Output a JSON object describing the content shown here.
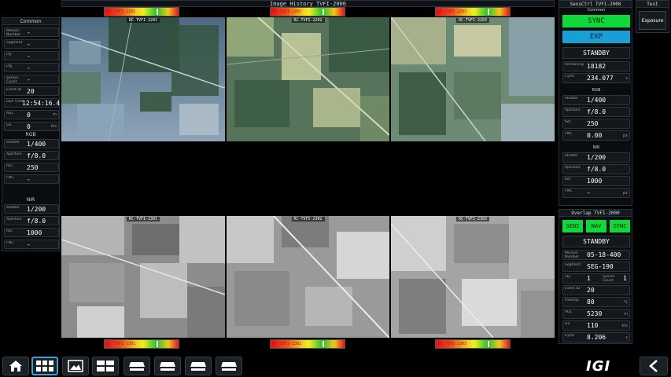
{
  "window": {
    "title": "Image History TVFI-2000"
  },
  "left_panel": {
    "common_title": "Common",
    "common_rows": [
      {
        "key": "Mission Number",
        "value": "-"
      },
      {
        "key": "Segment",
        "value": "-"
      },
      {
        "key": "Lty",
        "value": "-"
      },
      {
        "key": "Lfg",
        "value": "-"
      },
      {
        "key": "Sensor Count",
        "value": "-"
      },
      {
        "key": "Event ID",
        "value": "20"
      },
      {
        "key": "GEP Time",
        "value": "12:54:16.4"
      },
      {
        "key": "AGL",
        "value": "0",
        "unit": "m"
      },
      {
        "key": "GS",
        "value": "0",
        "unit": "kts"
      }
    ],
    "rgb_title": "RGB",
    "rgb_rows": [
      {
        "key": "Shutter",
        "value": "1/400"
      },
      {
        "key": "Aperture",
        "value": "f/8.0"
      },
      {
        "key": "ISO",
        "value": "250"
      },
      {
        "key": "FMC",
        "value": "-"
      }
    ],
    "nir_title": "NIR",
    "nir_rows": [
      {
        "key": "Shutter",
        "value": "1/200"
      },
      {
        "key": "Aperture",
        "value": "f/8.0"
      },
      {
        "key": "ISO",
        "value": "1000"
      },
      {
        "key": "FMC",
        "value": "-"
      }
    ]
  },
  "gauges": {
    "top": [
      {
        "label": "RC-TVFI-2201",
        "marker": 0.7
      },
      {
        "label": "RC-TVFI-2202",
        "marker": 0.7
      },
      {
        "label": "RC-TVFI-2203",
        "marker": 0.7
      }
    ],
    "bottom": [
      {
        "label": "RC-TVFI-2301",
        "marker": 0.7
      },
      {
        "label": "RC-TVFI-2302",
        "marker": 0.7
      },
      {
        "label": "RC-TVFI-2303",
        "marker": 0.7
      }
    ]
  },
  "tiles": {
    "top": [
      {
        "title": "RC-TVFI-2201"
      },
      {
        "title": "RC-TVFI-2202"
      },
      {
        "title": "RC-TVFI-2203"
      }
    ],
    "bottom": [
      {
        "title": "RC-TVFI-2301"
      },
      {
        "title": "RC-TVFI-2302"
      },
      {
        "title": "RC-TVFI-2303"
      }
    ]
  },
  "sensctrl": {
    "title": "SensCtrl TVFI-2000",
    "common_title": "Common",
    "sync_label": "SYNC",
    "exp_label": "EXP",
    "status": "STANDBY",
    "rows": [
      {
        "key": "Remaining",
        "value": "18182"
      },
      {
        "key": "Cycle",
        "value": "234.077",
        "unit": "s"
      }
    ],
    "rgb_title": "RGB",
    "rgb_rows": [
      {
        "key": "Shutter",
        "value": "1/400"
      },
      {
        "key": "Aperture",
        "value": "f/8.0"
      },
      {
        "key": "ISO",
        "value": "250"
      },
      {
        "key": "FMC",
        "value": "0.00",
        "unit": "px"
      }
    ],
    "nir_title": "NIR",
    "nir_rows": [
      {
        "key": "Shutter",
        "value": "1/200"
      },
      {
        "key": "Aperture",
        "value": "f/8.0"
      },
      {
        "key": "ISO",
        "value": "1000"
      },
      {
        "key": "FMC",
        "value": "-",
        "unit": "px"
      }
    ]
  },
  "overlap": {
    "title": "Overlap TVFI-2000",
    "btn_sens": "SENS",
    "btn_nav": "NAV",
    "btn_sync": "SYNC",
    "status": "STANDBY",
    "rows": [
      {
        "key": "Mission Number",
        "value": "05-18-400"
      },
      {
        "key": "Segment",
        "value": "SEG-190"
      },
      {
        "key": "Lty",
        "value": "1",
        "key2": "Sensor Count",
        "value2": "1"
      },
      {
        "key": "Event ID",
        "value": "20"
      },
      {
        "key": "Overlap",
        "value": "80",
        "unit": "%"
      },
      {
        "key": "AGL",
        "value": "5230",
        "unit": "m"
      },
      {
        "key": "GS",
        "value": "110",
        "unit": "kts"
      },
      {
        "key": "Cycle",
        "value": "8.206",
        "unit": "s"
      }
    ]
  },
  "test_panel": {
    "title": "Test",
    "exposure_label": "Exposure"
  },
  "bottom_bar": {
    "logo": "IGI"
  }
}
